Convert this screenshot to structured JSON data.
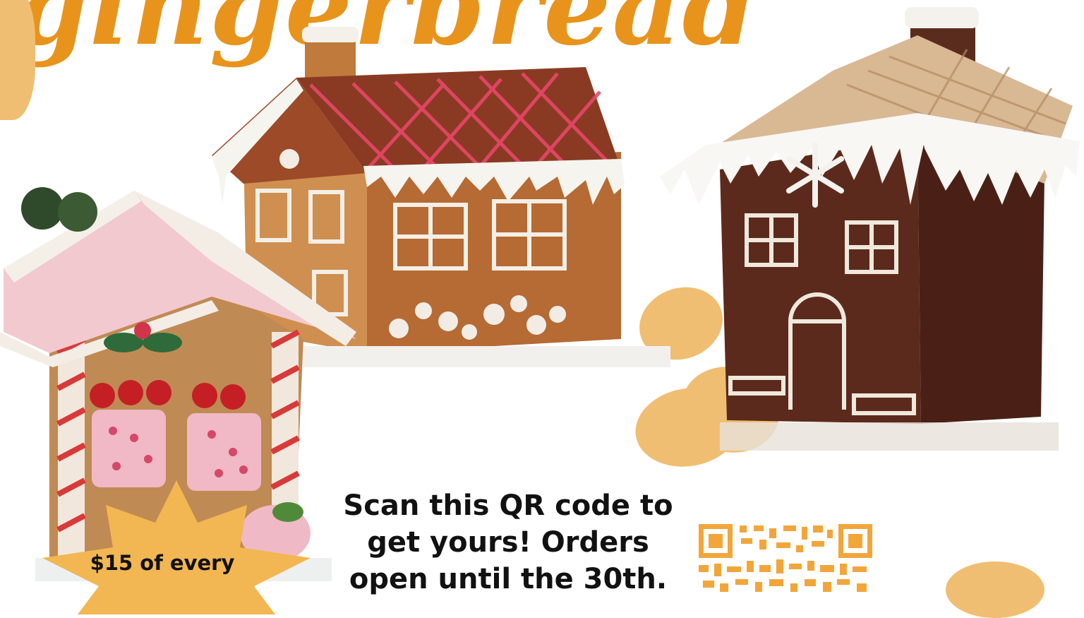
{
  "title": "gingerbread",
  "promo": {
    "headline": "Scan this QR code to get yours! Orders open until the 30th."
  },
  "badge": {
    "text": "$15 of every"
  },
  "colors": {
    "brand_orange": "#e8941c",
    "blob_orange": "#f0be72",
    "qr_orange": "#f2a63a"
  },
  "icons": [
    "qr-code-icon",
    "gingerbread-house-illustration"
  ]
}
